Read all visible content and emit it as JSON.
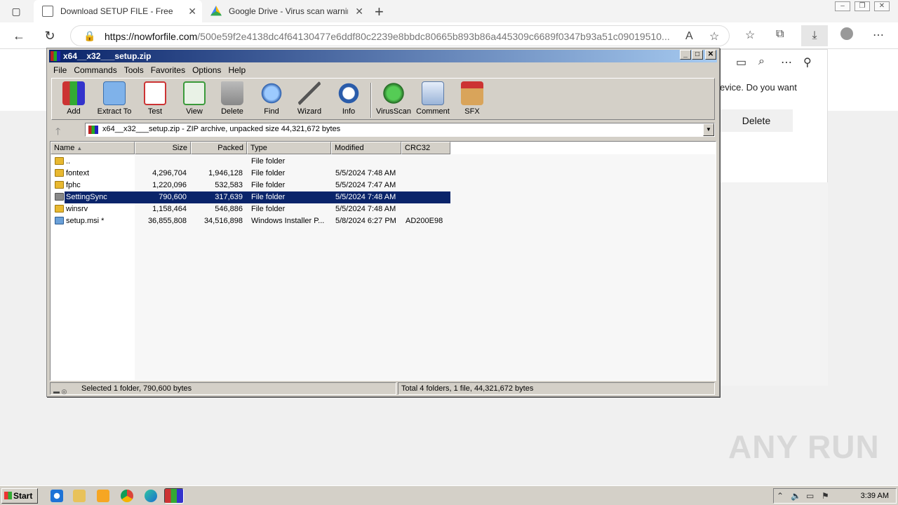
{
  "browser": {
    "tabs": [
      {
        "title": "Download SETUP FILE - Free",
        "active": true
      },
      {
        "title": "Google Drive - Virus scan warnin",
        "active": false
      }
    ],
    "url_domain": "https://nowforfile.com",
    "url_path": "/500e59f2e4138dc4f64130477e6ddf80c2239e8bbdc80665b893b86a445309c6689f0347b93a51c09019510..."
  },
  "download_panel": {
    "message": "evice. Do you want",
    "delete_label": "Delete"
  },
  "winrar": {
    "title": "x64__x32___setup.zip",
    "menu": [
      "File",
      "Commands",
      "Tools",
      "Favorites",
      "Options",
      "Help"
    ],
    "toolbar": [
      {
        "label": "Add",
        "icon": "add-icon"
      },
      {
        "label": "Extract To",
        "icon": "extract-to-icon"
      },
      {
        "label": "Test",
        "icon": "test-icon"
      },
      {
        "label": "View",
        "icon": "view-icon"
      },
      {
        "label": "Delete",
        "icon": "delete-icon"
      },
      {
        "label": "Find",
        "icon": "find-icon"
      },
      {
        "label": "Wizard",
        "icon": "wizard-icon"
      },
      {
        "label": "Info",
        "icon": "info-icon"
      },
      {
        "label": "VirusScan",
        "icon": "virus-scan-icon"
      },
      {
        "label": "Comment",
        "icon": "comment-icon"
      },
      {
        "label": "SFX",
        "icon": "sfx-icon"
      }
    ],
    "path_text": "x64__x32___setup.zip - ZIP archive, unpacked size 44,321,672 bytes",
    "columns": [
      "Name",
      "Size",
      "Packed",
      "Type",
      "Modified",
      "CRC32"
    ],
    "rows": [
      {
        "name": "..",
        "size": "",
        "packed": "",
        "type": "File folder",
        "modified": "",
        "crc": "",
        "icon": "folder",
        "selected": false
      },
      {
        "name": "fontext",
        "size": "4,296,704",
        "packed": "1,946,128",
        "type": "File folder",
        "modified": "5/5/2024 7:48 AM",
        "crc": "",
        "icon": "folder",
        "selected": false
      },
      {
        "name": "fphc",
        "size": "1,220,096",
        "packed": "532,583",
        "type": "File folder",
        "modified": "5/5/2024 7:47 AM",
        "crc": "",
        "icon": "folder",
        "selected": false
      },
      {
        "name": "SettingSync",
        "size": "790,600",
        "packed": "317,639",
        "type": "File folder",
        "modified": "5/5/2024 7:48 AM",
        "crc": "",
        "icon": "folder",
        "selected": true
      },
      {
        "name": "winsrv",
        "size": "1,158,464",
        "packed": "546,886",
        "type": "File folder",
        "modified": "5/5/2024 7:48 AM",
        "crc": "",
        "icon": "folder",
        "selected": false
      },
      {
        "name": "setup.msi *",
        "size": "36,855,808",
        "packed": "34,516,898",
        "type": "Windows Installer P...",
        "modified": "5/8/2024 6:27 PM",
        "crc": "AD200E98",
        "icon": "msi",
        "selected": false
      }
    ],
    "status_left": "Selected 1 folder, 790,600 bytes",
    "status_right": "Total 4 folders, 1 file, 44,321,672 bytes"
  },
  "watermark": "ANY RUN",
  "taskbar": {
    "start_label": "Start",
    "clock": "3:39 AM"
  }
}
